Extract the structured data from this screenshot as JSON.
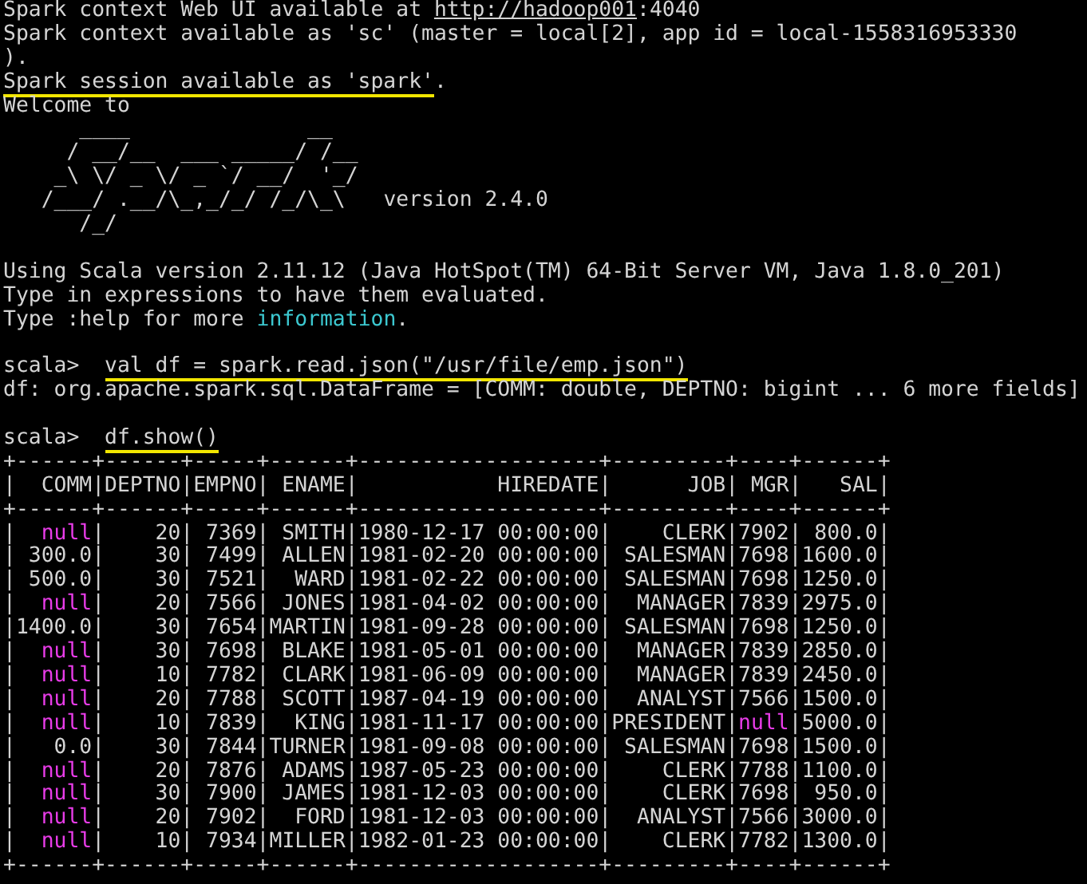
{
  "startup_lines": [
    {
      "segments": [
        {
          "text": "Spark context Web UI available at ",
          "kind": "plain"
        },
        {
          "text": "http://hadoop001",
          "kind": "link"
        },
        {
          "text": ":4040",
          "kind": "plain"
        }
      ]
    },
    {
      "segments": [
        {
          "text": "Spark context available as 'sc' (master = local[2], app id = local-1558316953330",
          "kind": "plain"
        }
      ]
    },
    {
      "segments": [
        {
          "text": ").",
          "kind": "plain"
        }
      ]
    },
    {
      "segments": [
        {
          "text": "Spark session available as 'spark'",
          "kind": "marked"
        },
        {
          "text": ".",
          "kind": "plain"
        }
      ]
    },
    {
      "segments": [
        {
          "text": "Welcome to",
          "kind": "plain"
        }
      ]
    }
  ],
  "logo": [
    {
      "art": "      ____              __"
    },
    {
      "art": "     / __/__  ___ _____/ /__"
    },
    {
      "art": "    _\\ \\/ _ \\/ _ `/ __/  '_/"
    },
    {
      "art": "   /___/ .__/\\_,_/_/ /_/\\_\\",
      "note": "version 2.4.0"
    },
    {
      "art": "      /_/"
    }
  ],
  "info_lines": [
    {
      "segments": [
        {
          "text": "Using Scala version 2.11.12 (Java HotSpot(TM) 64-Bit Server VM, Java 1.8.0_201)",
          "kind": "plain"
        }
      ]
    },
    {
      "segments": [
        {
          "text": "Type in expressions to have them evaluated.",
          "kind": "plain"
        }
      ]
    },
    {
      "segments": [
        {
          "text": "Type :help for more ",
          "kind": "plain"
        },
        {
          "text": "information",
          "kind": "info"
        },
        {
          "text": ".",
          "kind": "plain"
        }
      ]
    }
  ],
  "commands": [
    {
      "prompt": "scala>",
      "input": "val df = spark.read.json(\"/usr/file/emp.json\")",
      "highlighted": true,
      "output": "df: org.apache.spark.sql.DataFrame = [COMM: double, DEPTNO: bigint ... 6 more fields]"
    },
    {
      "prompt": "scala>",
      "input": "df.show()",
      "highlighted": true
    }
  ],
  "table": {
    "border": "+------+------+-----+------+-------------------+---------+----+------+",
    "separator": "|",
    "columns": [
      "COMM",
      "DEPTNO",
      "EMPNO",
      "ENAME",
      "HIREDATE",
      "JOB",
      "MGR",
      "SAL"
    ],
    "rows": [
      {
        "cells": [
          {
            "text": "null",
            "kind": "null"
          },
          {
            "text": "20",
            "kind": "value"
          },
          {
            "text": "7369",
            "kind": "value"
          },
          {
            "text": "SMITH",
            "kind": "value"
          },
          {
            "text": "1980-12-17 00:00:00",
            "kind": "value"
          },
          {
            "text": "CLERK",
            "kind": "value"
          },
          {
            "text": "7902",
            "kind": "value"
          },
          {
            "text": "800.0",
            "kind": "value"
          }
        ]
      },
      {
        "cells": [
          {
            "text": "300.0",
            "kind": "value"
          },
          {
            "text": "30",
            "kind": "value"
          },
          {
            "text": "7499",
            "kind": "value"
          },
          {
            "text": "ALLEN",
            "kind": "value"
          },
          {
            "text": "1981-02-20 00:00:00",
            "kind": "value"
          },
          {
            "text": "SALESMAN",
            "kind": "value"
          },
          {
            "text": "7698",
            "kind": "value"
          },
          {
            "text": "1600.0",
            "kind": "value"
          }
        ]
      },
      {
        "cells": [
          {
            "text": "500.0",
            "kind": "value"
          },
          {
            "text": "30",
            "kind": "value"
          },
          {
            "text": "7521",
            "kind": "value"
          },
          {
            "text": "WARD",
            "kind": "value"
          },
          {
            "text": "1981-02-22 00:00:00",
            "kind": "value"
          },
          {
            "text": "SALESMAN",
            "kind": "value"
          },
          {
            "text": "7698",
            "kind": "value"
          },
          {
            "text": "1250.0",
            "kind": "value"
          }
        ]
      },
      {
        "cells": [
          {
            "text": "null",
            "kind": "null"
          },
          {
            "text": "20",
            "kind": "value"
          },
          {
            "text": "7566",
            "kind": "value"
          },
          {
            "text": "JONES",
            "kind": "value"
          },
          {
            "text": "1981-04-02 00:00:00",
            "kind": "value"
          },
          {
            "text": "MANAGER",
            "kind": "value"
          },
          {
            "text": "7839",
            "kind": "value"
          },
          {
            "text": "2975.0",
            "kind": "value"
          }
        ]
      },
      {
        "cells": [
          {
            "text": "1400.0",
            "kind": "value"
          },
          {
            "text": "30",
            "kind": "value"
          },
          {
            "text": "7654",
            "kind": "value"
          },
          {
            "text": "MARTIN",
            "kind": "value"
          },
          {
            "text": "1981-09-28 00:00:00",
            "kind": "value"
          },
          {
            "text": "SALESMAN",
            "kind": "value"
          },
          {
            "text": "7698",
            "kind": "value"
          },
          {
            "text": "1250.0",
            "kind": "value"
          }
        ]
      },
      {
        "cells": [
          {
            "text": "null",
            "kind": "null"
          },
          {
            "text": "30",
            "kind": "value"
          },
          {
            "text": "7698",
            "kind": "value"
          },
          {
            "text": "BLAKE",
            "kind": "value"
          },
          {
            "text": "1981-05-01 00:00:00",
            "kind": "value"
          },
          {
            "text": "MANAGER",
            "kind": "value"
          },
          {
            "text": "7839",
            "kind": "value"
          },
          {
            "text": "2850.0",
            "kind": "value"
          }
        ]
      },
      {
        "cells": [
          {
            "text": "null",
            "kind": "null"
          },
          {
            "text": "10",
            "kind": "value"
          },
          {
            "text": "7782",
            "kind": "value"
          },
          {
            "text": "CLARK",
            "kind": "value"
          },
          {
            "text": "1981-06-09 00:00:00",
            "kind": "value"
          },
          {
            "text": "MANAGER",
            "kind": "value"
          },
          {
            "text": "7839",
            "kind": "value"
          },
          {
            "text": "2450.0",
            "kind": "value"
          }
        ]
      },
      {
        "cells": [
          {
            "text": "null",
            "kind": "null"
          },
          {
            "text": "20",
            "kind": "value"
          },
          {
            "text": "7788",
            "kind": "value"
          },
          {
            "text": "SCOTT",
            "kind": "value"
          },
          {
            "text": "1987-04-19 00:00:00",
            "kind": "value"
          },
          {
            "text": "ANALYST",
            "kind": "value"
          },
          {
            "text": "7566",
            "kind": "value"
          },
          {
            "text": "1500.0",
            "kind": "value"
          }
        ]
      },
      {
        "cells": [
          {
            "text": "null",
            "kind": "null"
          },
          {
            "text": "10",
            "kind": "value"
          },
          {
            "text": "7839",
            "kind": "value"
          },
          {
            "text": "KING",
            "kind": "value"
          },
          {
            "text": "1981-11-17 00:00:00",
            "kind": "value"
          },
          {
            "text": "PRESIDENT",
            "kind": "value"
          },
          {
            "text": "null",
            "kind": "null"
          },
          {
            "text": "5000.0",
            "kind": "value"
          }
        ]
      },
      {
        "cells": [
          {
            "text": "0.0",
            "kind": "value"
          },
          {
            "text": "30",
            "kind": "value"
          },
          {
            "text": "7844",
            "kind": "value"
          },
          {
            "text": "TURNER",
            "kind": "value"
          },
          {
            "text": "1981-09-08 00:00:00",
            "kind": "value"
          },
          {
            "text": "SALESMAN",
            "kind": "value"
          },
          {
            "text": "7698",
            "kind": "value"
          },
          {
            "text": "1500.0",
            "kind": "value"
          }
        ]
      },
      {
        "cells": [
          {
            "text": "null",
            "kind": "null"
          },
          {
            "text": "20",
            "kind": "value"
          },
          {
            "text": "7876",
            "kind": "value"
          },
          {
            "text": "ADAMS",
            "kind": "value"
          },
          {
            "text": "1987-05-23 00:00:00",
            "kind": "value"
          },
          {
            "text": "CLERK",
            "kind": "value"
          },
          {
            "text": "7788",
            "kind": "value"
          },
          {
            "text": "1100.0",
            "kind": "value"
          }
        ]
      },
      {
        "cells": [
          {
            "text": "null",
            "kind": "null"
          },
          {
            "text": "30",
            "kind": "value"
          },
          {
            "text": "7900",
            "kind": "value"
          },
          {
            "text": "JAMES",
            "kind": "value"
          },
          {
            "text": "1981-12-03 00:00:00",
            "kind": "value"
          },
          {
            "text": "CLERK",
            "kind": "value"
          },
          {
            "text": "7698",
            "kind": "value"
          },
          {
            "text": "950.0",
            "kind": "value"
          }
        ]
      },
      {
        "cells": [
          {
            "text": "null",
            "kind": "null"
          },
          {
            "text": "20",
            "kind": "value"
          },
          {
            "text": "7902",
            "kind": "value"
          },
          {
            "text": "FORD",
            "kind": "value"
          },
          {
            "text": "1981-12-03 00:00:00",
            "kind": "value"
          },
          {
            "text": "ANALYST",
            "kind": "value"
          },
          {
            "text": "7566",
            "kind": "value"
          },
          {
            "text": "3000.0",
            "kind": "value"
          }
        ]
      },
      {
        "cells": [
          {
            "text": "null",
            "kind": "null"
          },
          {
            "text": "10",
            "kind": "value"
          },
          {
            "text": "7934",
            "kind": "value"
          },
          {
            "text": "MILLER",
            "kind": "value"
          },
          {
            "text": "1982-01-23 00:00:00",
            "kind": "value"
          },
          {
            "text": "CLERK",
            "kind": "value"
          },
          {
            "text": "7782",
            "kind": "value"
          },
          {
            "text": "1300.0",
            "kind": "value"
          }
        ]
      }
    ]
  }
}
